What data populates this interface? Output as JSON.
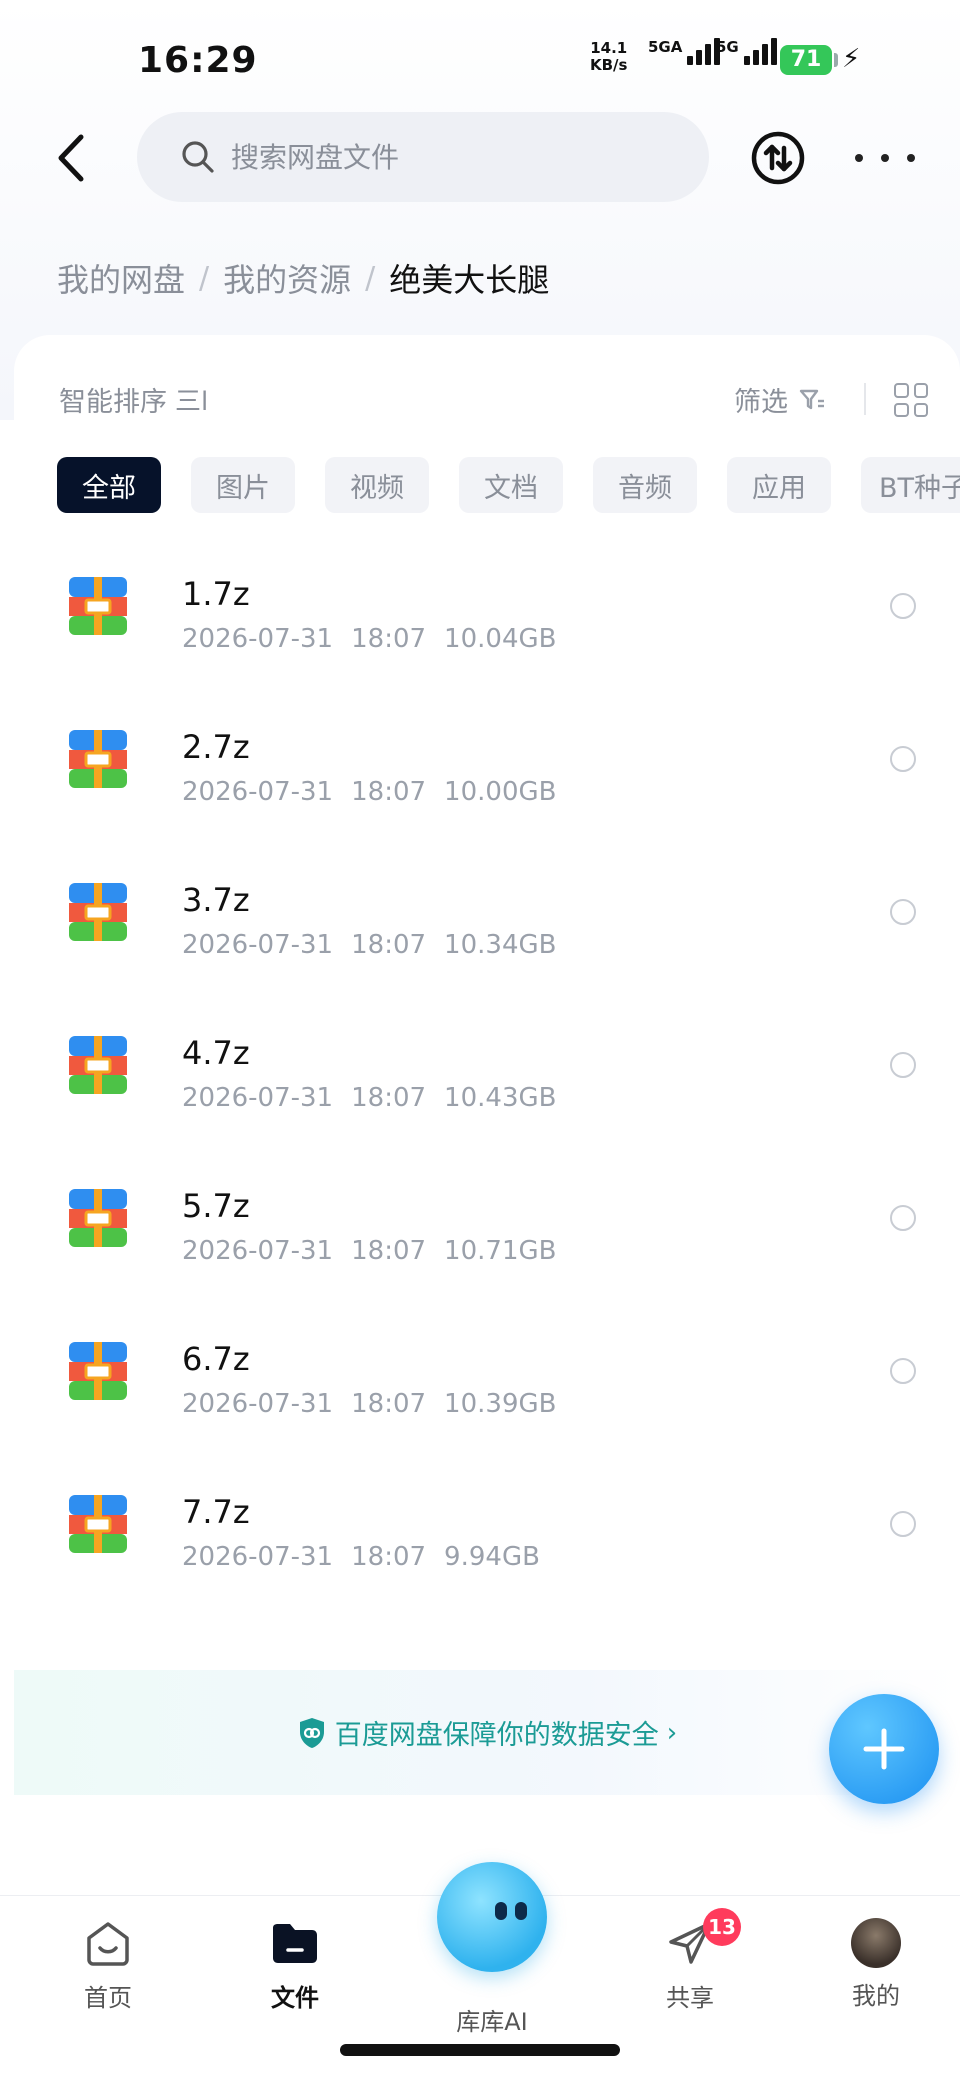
{
  "status_bar": {
    "time": "16:29",
    "net_speed_value": "14.1",
    "net_speed_unit": "KB/s",
    "sim1_label": "5GA",
    "sim2_label": "5G",
    "battery": "71"
  },
  "header": {
    "search_placeholder": "搜索网盘文件"
  },
  "breadcrumb": [
    "我的网盘",
    "我的资源",
    "绝美大长腿"
  ],
  "toolbar": {
    "sort_label": "智能排序",
    "sort_icon": "三l",
    "filter_label": "筛选"
  },
  "chips": [
    "全部",
    "图片",
    "视频",
    "文档",
    "音频",
    "应用",
    "BT种子"
  ],
  "files": [
    {
      "name": "1.7z",
      "date": "2026-07-31",
      "time": "18:07",
      "size": "10.04GB"
    },
    {
      "name": "2.7z",
      "date": "2026-07-31",
      "time": "18:07",
      "size": "10.00GB"
    },
    {
      "name": "3.7z",
      "date": "2026-07-31",
      "time": "18:07",
      "size": "10.34GB"
    },
    {
      "name": "4.7z",
      "date": "2026-07-31",
      "time": "18:07",
      "size": "10.43GB"
    },
    {
      "name": "5.7z",
      "date": "2026-07-31",
      "time": "18:07",
      "size": "10.71GB"
    },
    {
      "name": "6.7z",
      "date": "2026-07-31",
      "time": "18:07",
      "size": "10.39GB"
    },
    {
      "name": "7.7z",
      "date": "2026-07-31",
      "time": "18:07",
      "size": "9.94GB"
    }
  ],
  "security_banner": "百度网盘保障你的数据安全",
  "nav": {
    "home": "首页",
    "files": "文件",
    "ai": "库库AI",
    "share": "共享",
    "share_badge": "13",
    "me": "我的"
  },
  "colors": {
    "accent": "#1a8ff0",
    "active_chip": "#06122a",
    "security": "#1b9b95",
    "badge": "#ff3b5c"
  }
}
